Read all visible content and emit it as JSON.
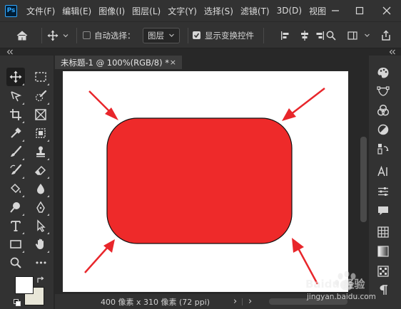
{
  "app": {
    "logo_text": "Ps",
    "brand_color": "#31a8ff"
  },
  "menu": {
    "items": [
      {
        "label": "文件(F)"
      },
      {
        "label": "编辑(E)"
      },
      {
        "label": "图像(I)"
      },
      {
        "label": "图层(L)"
      },
      {
        "label": "文字(Y)"
      },
      {
        "label": "选择(S)"
      },
      {
        "label": "滤镜(T)"
      },
      {
        "label": "3D(D)"
      },
      {
        "label": "视图"
      }
    ]
  },
  "options": {
    "auto_select_label": "自动选择：",
    "auto_select_checked": false,
    "auto_select_target": "图层",
    "show_transform_label": "显示变换控件",
    "show_transform_checked": true
  },
  "document": {
    "tab_title": "未标题-1 @ 100%(RGB/8) *",
    "close_glyph": "×",
    "shape_color": "#ee2a2a",
    "arrow_color": "#e8262b"
  },
  "statusbar": {
    "info": "400 像素 x 310 像素 (72 ppi)",
    "nav_glyph": "›"
  },
  "tools": {
    "active": "move-tool",
    "foreground_color": "#ffffff",
    "background_color": "#e8e6d8",
    "more_glyph": "•••"
  },
  "watermark": {
    "brand_text": "Baidu 经验",
    "url": "jingyan.baidu.com"
  }
}
